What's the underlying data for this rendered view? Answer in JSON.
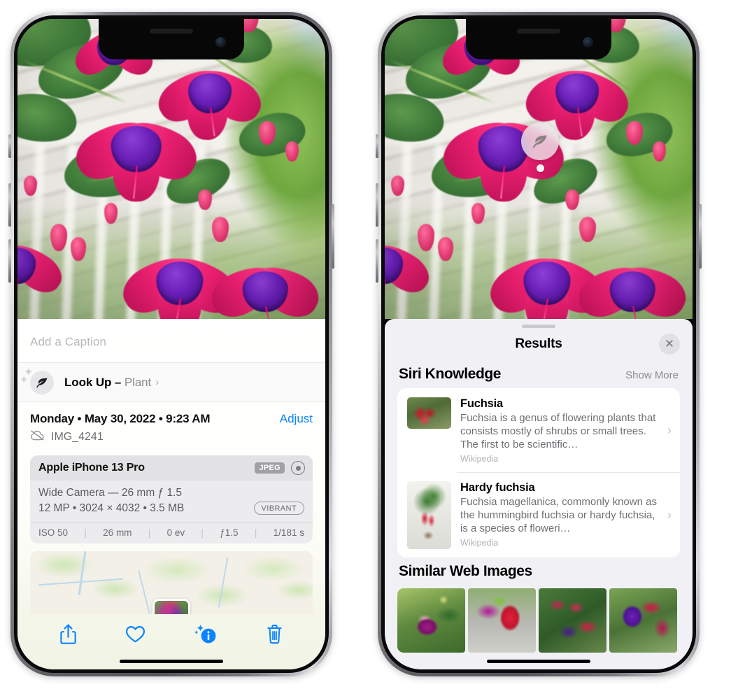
{
  "left_phone": {
    "caption_placeholder": "Add a Caption",
    "lookup": {
      "label": "Look Up",
      "dash": " – ",
      "subject": "Plant",
      "chevron": "›",
      "icon": "leaf-icon",
      "sparkle": "✦",
      "sparkle_small": "✚"
    },
    "metadata": {
      "date_line": "Monday • May 30, 2022 • 9:23 AM",
      "adjust_label": "Adjust",
      "filename": "IMG_4241",
      "cloud_icon": "cloud-slash-icon"
    },
    "exif": {
      "device": "Apple iPhone 13 Pro",
      "format_tag": "JPEG",
      "raw_icon": "raw-aperture-icon",
      "lens_line": "Wide Camera — 26 mm ƒ 1.5",
      "size_line": "12 MP • 3024 × 4032 • 3.5 MB",
      "style_tag": "VIBRANT",
      "settings": [
        "ISO 50",
        "26 mm",
        "0 ev",
        "ƒ1.5",
        "1/181 s"
      ],
      "separator": "|"
    },
    "map": {
      "name": "location-map-thumbnail"
    },
    "toolbar": [
      {
        "name": "share-button",
        "icon": "share-icon"
      },
      {
        "name": "favorite-button",
        "icon": "heart-icon"
      },
      {
        "name": "info-button",
        "icon": "info-sparkle-icon"
      },
      {
        "name": "delete-button",
        "icon": "trash-icon"
      }
    ]
  },
  "right_phone": {
    "badge": {
      "icon": "leaf-icon",
      "name": "visual-look-up-badge"
    },
    "sheet": {
      "title": "Results",
      "close_icon": "✕",
      "sections": [
        {
          "title": "Siri Knowledge",
          "action": "Show More",
          "items": [
            {
              "name": "Fuchsia",
              "description": "Fuchsia is a genus of flowering plants that consists mostly of shrubs or small trees. The first to be scientific…",
              "source": "Wikipedia",
              "chevron": "›",
              "thumb": "fuchsia-red-flowers-thumbnail"
            },
            {
              "name": "Hardy fuchsia",
              "description": "Fuchsia magellanica, commonly known as the hummingbird fuchsia or hardy fuchsia, is a species of floweri…",
              "source": "Wikipedia",
              "chevron": "›",
              "thumb": "hardy-fuchsia-specimen-thumbnail"
            }
          ]
        },
        {
          "title": "Similar Web Images",
          "images": [
            "similar-image-1-pink-purple-fuchsia",
            "similar-image-2-red-fuchsia-closeup",
            "similar-image-3-fuchsia-bush",
            "similar-image-4-purple-pink-fuchsia"
          ]
        }
      ]
    }
  },
  "colors": {
    "accent_blue": "#0a84ff",
    "sheet_bg": "#f1f1f5",
    "card_white": "#ffffff",
    "secondary_text": "#6f6f75",
    "tertiary_text": "#b3b3b8"
  }
}
